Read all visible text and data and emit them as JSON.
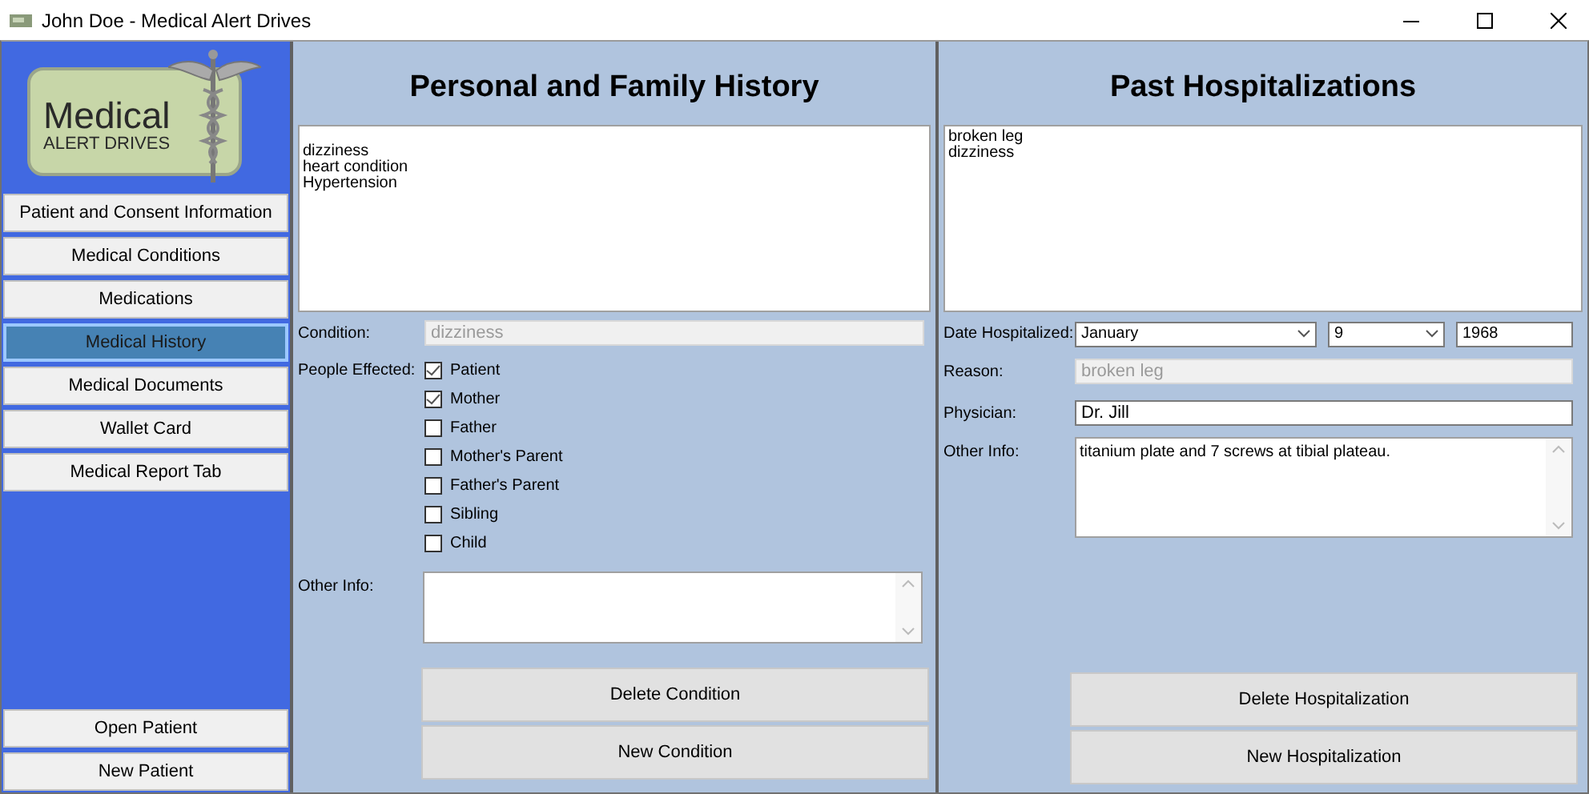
{
  "window": {
    "title": "John Doe - Medical Alert Drives"
  },
  "logo": {
    "line1": "Medical",
    "line2": "ALERT DRIVES"
  },
  "sidebar": {
    "items": [
      {
        "label": "Patient and Consent Information",
        "selected": false
      },
      {
        "label": "Medical Conditions",
        "selected": false
      },
      {
        "label": "Medications",
        "selected": false
      },
      {
        "label": "Medical History",
        "selected": true
      },
      {
        "label": "Medical Documents",
        "selected": false
      },
      {
        "label": "Wallet Card",
        "selected": false
      },
      {
        "label": "Medical Report Tab",
        "selected": false
      }
    ],
    "bottom_buttons": [
      "Open Patient",
      "New Patient"
    ]
  },
  "family_history": {
    "title": "Personal and Family History",
    "list": [
      "dizziness",
      "heart condition",
      "Hypertension"
    ],
    "condition_label": "Condition:",
    "condition": {
      "value": "dizziness",
      "disabled": true
    },
    "people_label": "People Effected:",
    "people": [
      {
        "label": "Patient",
        "checked": true
      },
      {
        "label": "Mother",
        "checked": true
      },
      {
        "label": "Father",
        "checked": false
      },
      {
        "label": "Mother's Parent",
        "checked": false
      },
      {
        "label": "Father's Parent",
        "checked": false
      },
      {
        "label": "Sibling",
        "checked": false
      },
      {
        "label": "Child",
        "checked": false
      }
    ],
    "other_info_label": "Other Info:",
    "buttons": [
      "Delete Condition",
      "New Condition"
    ]
  },
  "hospitalizations": {
    "title": "Past Hospitalizations",
    "list": [
      "broken leg",
      "dizziness"
    ],
    "date_label": "Date Hospitalized:",
    "month": "January",
    "day": "9",
    "year": "1968",
    "reason_label": "Reason:",
    "reason": {
      "value": "broken leg",
      "disabled": true
    },
    "physician_label": "Physician:",
    "physician": {
      "value": "Dr. Jill",
      "disabled": false
    },
    "other_info_label": "Other Info:",
    "other_info": "titanium plate and 7 screws at tibial plateau.",
    "buttons": [
      "Delete Hospitalization",
      "New Hospitalization"
    ]
  }
}
